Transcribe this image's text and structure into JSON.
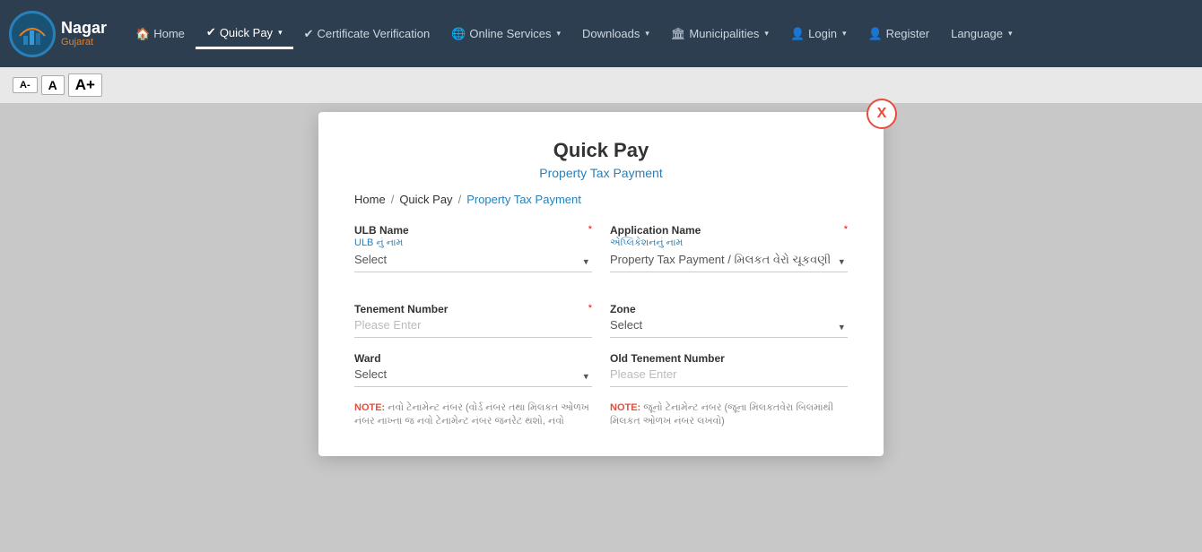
{
  "nav": {
    "logo_text": "Nagar",
    "logo_sub": "Gujarat",
    "items": [
      {
        "label": "Home",
        "icon": "🏠",
        "active": false,
        "has_dropdown": false
      },
      {
        "label": "Quick Pay",
        "icon": "✔",
        "active": true,
        "has_dropdown": true
      },
      {
        "label": "Certificate Verification",
        "icon": "✔",
        "active": false,
        "has_dropdown": false
      },
      {
        "label": "Online Services",
        "icon": "🌐",
        "active": false,
        "has_dropdown": true
      },
      {
        "label": "Downloads",
        "icon": "",
        "active": false,
        "has_dropdown": true
      },
      {
        "label": "Municipalities",
        "icon": "🏛",
        "active": false,
        "has_dropdown": true
      },
      {
        "label": "Login",
        "icon": "👤",
        "active": false,
        "has_dropdown": true
      },
      {
        "label": "Register",
        "icon": "👤",
        "active": false,
        "has_dropdown": false
      },
      {
        "label": "Language",
        "icon": "",
        "active": false,
        "has_dropdown": true
      }
    ]
  },
  "font_controls": {
    "small": "A-",
    "medium": "A",
    "large": "A+"
  },
  "modal": {
    "close_icon": "X",
    "title": "Quick Pay",
    "subtitle": "Property Tax Payment",
    "breadcrumb": {
      "home": "Home",
      "quick_pay": "Quick Pay",
      "current": "Property Tax Payment"
    },
    "ulb_name": {
      "label": "ULB Name",
      "label_guj": "ULB નું નામ",
      "placeholder": "Select",
      "required": true
    },
    "application_name": {
      "label": "Application Name",
      "label_guj": "એપ્લિકેશનનું નામ",
      "value": "Property Tax Payment / મિલકત વેરો ચૂકવણી",
      "required": true
    },
    "tenement_number": {
      "label": "Tenement Number",
      "placeholder": "Please Enter",
      "required": true
    },
    "zone": {
      "label": "Zone",
      "placeholder": "Select"
    },
    "ward": {
      "label": "Ward",
      "placeholder": "Select"
    },
    "old_tenement_number": {
      "label": "Old Tenement Number",
      "placeholder": "Please Enter"
    },
    "note_left": "NOTE: નવો ટેનામેન્ટ નંબર (વોર્ડ નંબર તથા મિલકત ઓળખ નંબર નાખ્તા જ નવો ટેનામેન્ટ નંબર જનરેટ થશો, નવો",
    "note_right": "NOTE: જૂનો ટેનામેન્ટ નંબર (જૂના મિલકતવેરા બિલમાંથી મિલકત ઓળખ નંબર લખવો)"
  }
}
